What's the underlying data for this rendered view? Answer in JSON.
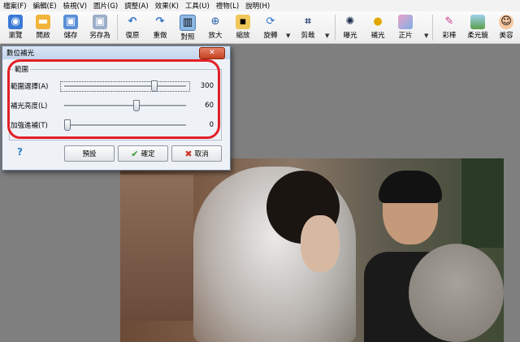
{
  "menubar": {
    "items": [
      "檔案(F)",
      "編輯(E)",
      "檢視(V)",
      "圖片(G)",
      "調整(A)",
      "效果(K)",
      "工具(U)",
      "禮物(L)",
      "說明(H)"
    ]
  },
  "toolbar": {
    "tools": [
      {
        "label": "瀏覽",
        "icon": "browse-icon"
      },
      {
        "label": "開啟",
        "icon": "folder-icon"
      },
      {
        "label": "儲存",
        "icon": "save-icon"
      },
      {
        "label": "另存為",
        "icon": "save-as-icon"
      },
      {
        "label": "復原",
        "icon": "undo-icon"
      },
      {
        "label": "重做",
        "icon": "redo-icon"
      },
      {
        "label": "對照",
        "icon": "compare-icon"
      },
      {
        "label": "放大",
        "icon": "zoom-in-icon"
      },
      {
        "label": "縮放",
        "icon": "resize-icon"
      },
      {
        "label": "旋轉",
        "icon": "rotate-icon"
      },
      {
        "label": "剪裁",
        "icon": "crop-icon"
      },
      {
        "label": "曝光",
        "icon": "exposure-icon"
      },
      {
        "label": "補光",
        "icon": "fill-light-icon"
      },
      {
        "label": "正片",
        "icon": "positive-film-icon"
      },
      {
        "label": "彩棒",
        "icon": "color-wand-icon"
      },
      {
        "label": "柔光鏡",
        "icon": "soft-light-icon"
      },
      {
        "label": "美容",
        "icon": "beauty-icon"
      }
    ]
  },
  "dialog": {
    "title": "數位補光",
    "close_symbol": "✕",
    "group_label": "範圍",
    "sliders": [
      {
        "label": "範圍選擇(A)",
        "value": "300",
        "fraction": 0.75
      },
      {
        "label": "補光亮度(L)",
        "value": "60",
        "fraction": 0.6
      },
      {
        "label": "加強進補(T)",
        "value": "0",
        "fraction": 0.0
      }
    ],
    "help_symbol": "?",
    "buttons": {
      "default": "預設",
      "ok": "確定",
      "cancel": "取消"
    }
  },
  "colors": {
    "highlight_ring": "#e21f26",
    "ok_check": "#2f9a2f",
    "cancel_x": "#d0352a"
  }
}
